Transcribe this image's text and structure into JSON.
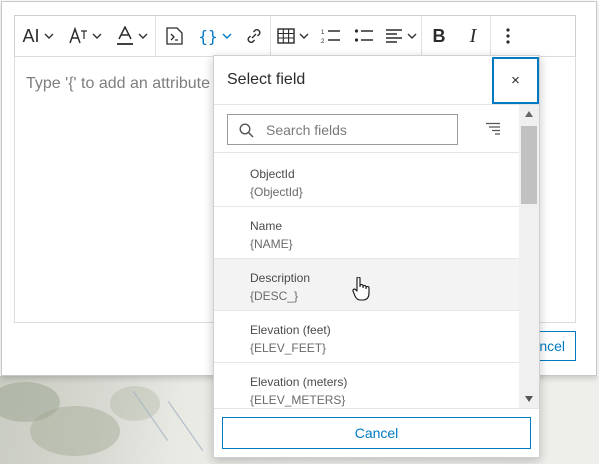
{
  "editor": {
    "placeholder": "Type '{' to add an attribute",
    "toolbar": {
      "ai_label": "AI",
      "buttons": [
        {
          "icon": "ai-icon"
        },
        {
          "icon": "font-size-icon"
        },
        {
          "icon": "font-color-icon"
        },
        {
          "icon": "insert-expression-icon"
        },
        {
          "icon": "insert-field-icon"
        },
        {
          "icon": "link-icon"
        },
        {
          "icon": "table-icon"
        },
        {
          "icon": "numbered-list-icon"
        },
        {
          "icon": "bullet-list-icon"
        },
        {
          "icon": "align-icon"
        },
        {
          "icon": "bold-icon"
        },
        {
          "icon": "italic-icon"
        },
        {
          "icon": "more-icon"
        }
      ]
    },
    "background_cancel_label": "ncel"
  },
  "field_picker": {
    "title": "Select field",
    "close_label": "×",
    "search_placeholder": "Search fields",
    "cancel_label": "Cancel",
    "fields": [
      {
        "label": "ObjectId",
        "value": "{ObjectId}"
      },
      {
        "label": "Name",
        "value": "{NAME}"
      },
      {
        "label": "Description",
        "value": "{DESC_}"
      },
      {
        "label": "Elevation (feet)",
        "value": "{ELEV_FEET}"
      },
      {
        "label": "Elevation (meters)",
        "value": "{ELEV_METERS}"
      }
    ],
    "hovered_index": 2
  },
  "colors": {
    "accent": "#007ac2",
    "text": "#2b2b2b",
    "hover_row": "#f3f3f3"
  }
}
